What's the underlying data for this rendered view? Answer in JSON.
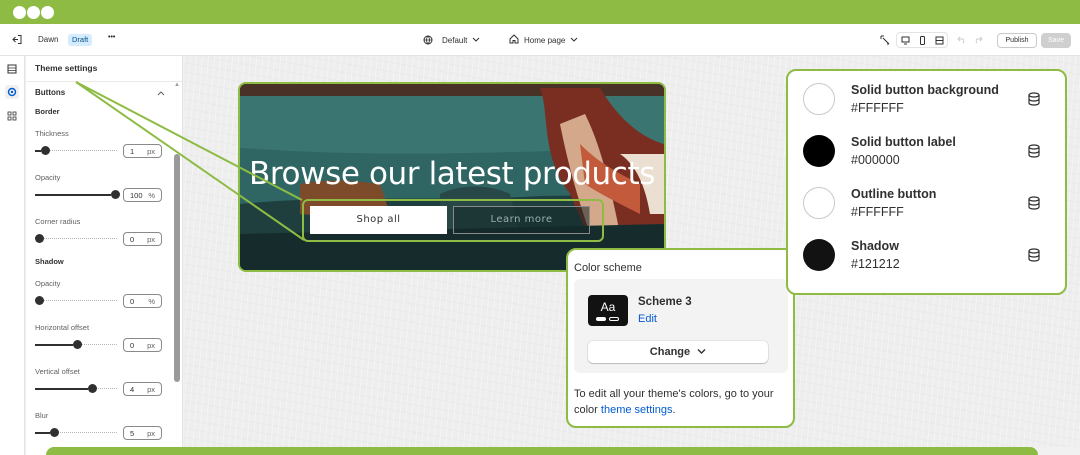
{
  "header": {
    "theme_name": "Dawn",
    "status_badge": "Draft",
    "more_label": "•••",
    "template_selector": "Default",
    "page_selector": "Home page",
    "publish_label": "Publish",
    "save_label": "Save"
  },
  "panel": {
    "title": "Theme settings",
    "section_title": "Buttons",
    "border_title": "Border",
    "shadow_title": "Shadow",
    "fields": [
      {
        "label": "Thickness",
        "value": "1",
        "unit": "px",
        "level": 0.08
      },
      {
        "label": "Opacity",
        "value": "100",
        "unit": "%",
        "level": 1.0
      },
      {
        "label": "Corner radius",
        "value": "0",
        "unit": "px",
        "level": 0.0
      },
      {
        "label": "Opacity",
        "value": "0",
        "unit": "%",
        "level": 0.0
      },
      {
        "label": "Horizontal offset",
        "value": "0",
        "unit": "px",
        "level": 0.5
      },
      {
        "label": "Vertical offset",
        "value": "4",
        "unit": "px",
        "level": 0.7
      },
      {
        "label": "Blur",
        "value": "5",
        "unit": "px",
        "level": 0.2
      }
    ]
  },
  "hero": {
    "heading": "Browse our latest products",
    "primary_button": "Shop all",
    "secondary_button": "Learn more"
  },
  "color_scheme": {
    "label": "Color scheme",
    "swatch_text": "Aa",
    "scheme_name": "Scheme 3",
    "edit_link": "Edit",
    "change_button": "Change",
    "help_text": "To edit all your theme's colors, go to your color",
    "help_link": "theme settings",
    "help_end": "."
  },
  "colors": [
    {
      "name": "Solid button background",
      "hex": "#FFFFFF",
      "swatch": "#FFFFFF"
    },
    {
      "name": "Solid button label",
      "hex": "#000000",
      "swatch": "#000000"
    },
    {
      "name": "Outline button",
      "hex": "#FFFFFF",
      "swatch": "#FFFFFF"
    },
    {
      "name": "Shadow",
      "hex": "#121212",
      "swatch": "#121212"
    }
  ],
  "accent_color": "#8dbb43",
  "link_color": "#005bd3"
}
